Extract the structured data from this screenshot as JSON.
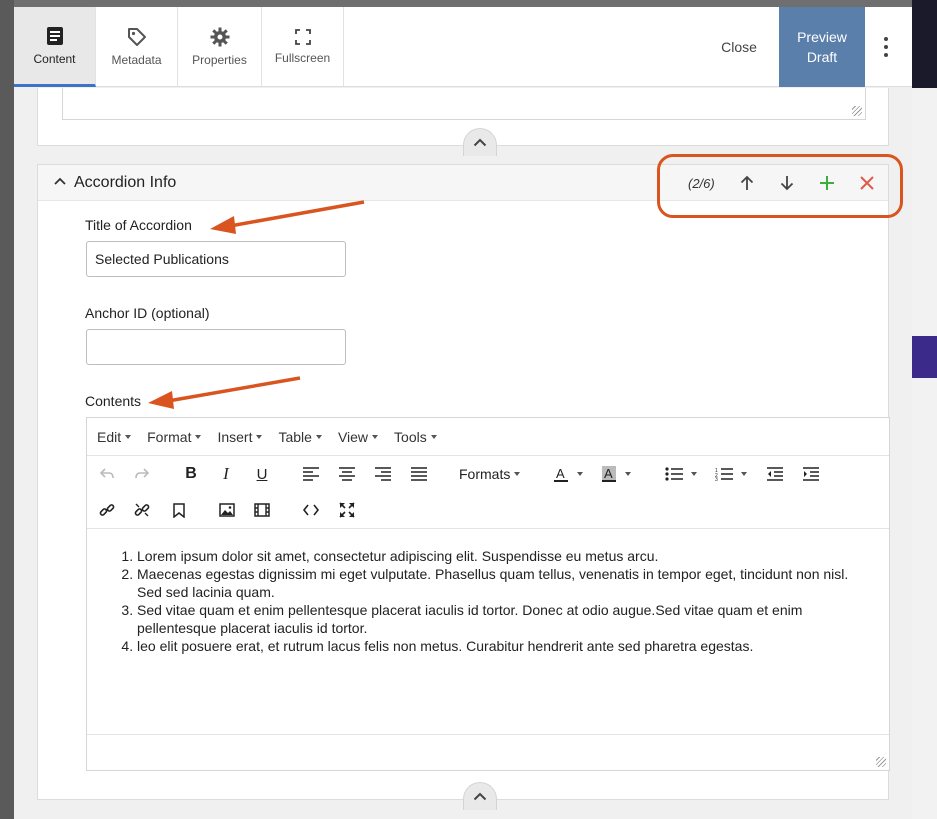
{
  "tabs": [
    {
      "label": "Content",
      "icon": "document-icon",
      "active": true
    },
    {
      "label": "Metadata",
      "icon": "tag-icon",
      "active": false
    },
    {
      "label": "Properties",
      "icon": "gear-icon",
      "active": false
    },
    {
      "label": "Fullscreen",
      "icon": "fullscreen-icon",
      "active": false
    }
  ],
  "header": {
    "close_label": "Close",
    "preview_line1": "Preview",
    "preview_line2": "Draft"
  },
  "accordion": {
    "title": "Accordion Info",
    "counter": "(2/6)",
    "title_label": "Title of Accordion",
    "title_value": "Selected Publications",
    "anchor_label": "Anchor ID (optional)",
    "anchor_value": "",
    "contents_label": "Contents"
  },
  "editor": {
    "menus": [
      "Edit",
      "Format",
      "Insert",
      "Table",
      "View",
      "Tools"
    ],
    "formats_label": "Formats",
    "list_items": [
      "Lorem ipsum dolor sit amet, consectetur adipiscing elit. Suspendisse eu metus arcu.",
      "Maecenas egestas dignissim mi eget vulputate. Phasellus quam tellus, venenatis in tempor eget, tincidunt non nisl. Sed sed lacinia quam.",
      "Sed vitae quam et enim pellentesque placerat iaculis id tortor. Donec at odio augue.Sed vitae quam et enim pellentesque placerat iaculis id tortor.",
      "leo elit posuere erat, et rutrum lacus felis non metus. Curabitur hendrerit ante sed pharetra egestas."
    ]
  },
  "colors": {
    "accent": "#3d73c7",
    "preview_bg": "#5b7fab",
    "annotation": "#d9541e",
    "add": "#3cae3c",
    "remove": "#e05a4a"
  }
}
